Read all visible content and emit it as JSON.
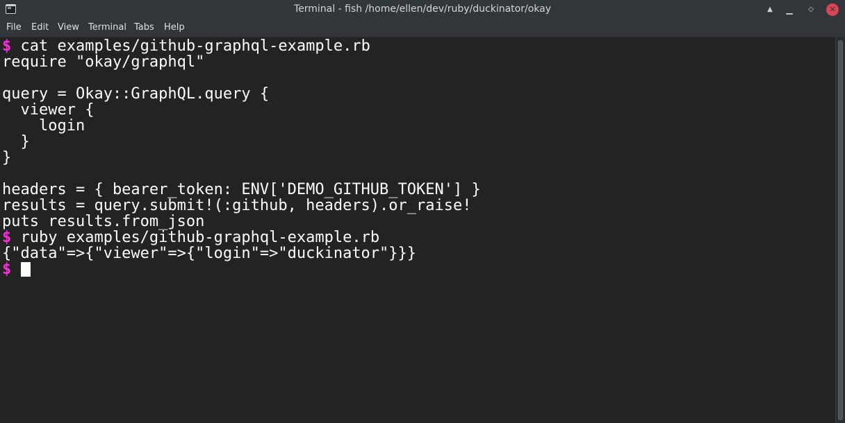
{
  "window": {
    "title": "Terminal - fish  /home/ellen/dev/ruby/duckinator/okay",
    "icon": "terminal-icon",
    "controls": {
      "keep_above": "▲",
      "minimize": "▁",
      "maximize": "◇",
      "close": "✕"
    }
  },
  "menu": {
    "items": [
      "File",
      "Edit",
      "View",
      "Terminal",
      "Tabs",
      "Help"
    ]
  },
  "terminal": {
    "prompt_symbol": "$",
    "lines": [
      {
        "prompt": true,
        "text": "cat examples/github-graphql-example.rb"
      },
      {
        "prompt": false,
        "text": "require \"okay/graphql\""
      },
      {
        "prompt": false,
        "text": ""
      },
      {
        "prompt": false,
        "text": "query = Okay::GraphQL.query {"
      },
      {
        "prompt": false,
        "text": "  viewer {"
      },
      {
        "prompt": false,
        "text": "    login"
      },
      {
        "prompt": false,
        "text": "  }"
      },
      {
        "prompt": false,
        "text": "}"
      },
      {
        "prompt": false,
        "text": ""
      },
      {
        "prompt": false,
        "text": "headers = { bearer_token: ENV['DEMO_GITHUB_TOKEN'] }"
      },
      {
        "prompt": false,
        "text": "results = query.submit!(:github, headers).or_raise!"
      },
      {
        "prompt": false,
        "text": "puts results.from_json"
      },
      {
        "prompt": true,
        "text": "ruby examples/github-graphql-example.rb"
      },
      {
        "prompt": false,
        "text": "{\"data\"=>{\"viewer\"=>{\"login\"=>\"duckinator\"}}}"
      },
      {
        "prompt": true,
        "text": ""
      }
    ]
  },
  "colors": {
    "background": "#232323",
    "foreground": "#fcfcfc",
    "prompt": "#ff2bdc",
    "chrome": "#31363b",
    "close_button": "#da4453"
  }
}
